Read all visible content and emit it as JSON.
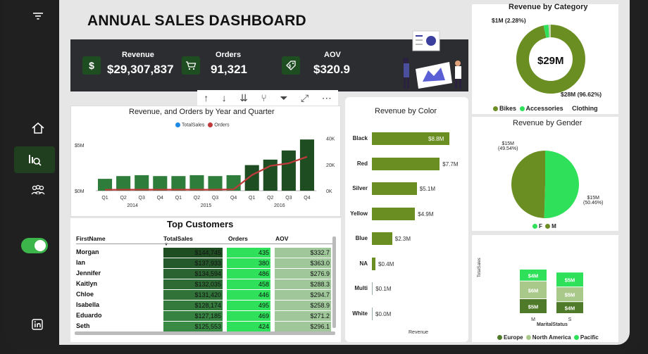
{
  "title": "ANNUAL SALES DASHBOARD",
  "colors": {
    "dark_green": "#1f5a2a",
    "olive": "#6b8e23",
    "bright_green": "#2ee05a",
    "line_red": "#c0393b",
    "kpi_band": "#2b2d30"
  },
  "sidebar": {
    "items": [
      {
        "name": "filter-icon"
      },
      {
        "name": "home-icon"
      },
      {
        "name": "analytics-icon"
      },
      {
        "name": "people-icon"
      },
      {
        "name": "toggle"
      },
      {
        "name": "linkedin-icon"
      }
    ]
  },
  "kpis": [
    {
      "label": "Revenue",
      "value": "$29,307,837",
      "icon": "$"
    },
    {
      "label": "Orders",
      "value": "91,321",
      "icon": "cart-icon"
    },
    {
      "label": "AOV",
      "value": "$320.9",
      "icon": "tag-icon"
    }
  ],
  "toolbar": {
    "icons": [
      "↑",
      "↓",
      "⇊",
      "⑂",
      "⏷",
      "⤢",
      "⋯"
    ]
  },
  "combo_chart": {
    "title": "Revenue, and Orders by Year and Quarter",
    "legend": [
      {
        "label": "TotalSales"
      },
      {
        "label": "Orders"
      }
    ],
    "left_ticks": [
      "$5M",
      "$0M"
    ],
    "right_ticks": [
      "40K",
      "20K",
      "0K"
    ],
    "quarters": [
      "Q1",
      "Q2",
      "Q3",
      "Q4",
      "Q1",
      "Q2",
      "Q3",
      "Q4",
      "Q1",
      "Q2",
      "Q3",
      "Q4"
    ],
    "years": [
      "2014",
      "2015",
      "2016"
    ]
  },
  "top_customers": {
    "title": "Top Customers",
    "headers": {
      "name": "FirstName",
      "sales": "TotalSales",
      "orders": "Orders",
      "aov": "AOV"
    },
    "rows": [
      {
        "name": "Morgan",
        "sales": "$144,745",
        "orders": "435",
        "aov": "$332.7"
      },
      {
        "name": "Ian",
        "sales": "$137,933",
        "orders": "380",
        "aov": "$363.0"
      },
      {
        "name": "Jennifer",
        "sales": "$134,594",
        "orders": "486",
        "aov": "$276.9"
      },
      {
        "name": "Kaitlyn",
        "sales": "$132,035",
        "orders": "458",
        "aov": "$288.3"
      },
      {
        "name": "Chloe",
        "sales": "$131,420",
        "orders": "446",
        "aov": "$294.7"
      },
      {
        "name": "Isabella",
        "sales": "$128,174",
        "orders": "495",
        "aov": "$258.9"
      },
      {
        "name": "Eduardo",
        "sales": "$127,185",
        "orders": "469",
        "aov": "$271.2"
      },
      {
        "name": "Seth",
        "sales": "$125,553",
        "orders": "424",
        "aov": "$296.1"
      }
    ]
  },
  "revenue_by_color": {
    "title": "Revenue by Color",
    "xlabel": "Revenue",
    "items": [
      {
        "label": "Black",
        "value": 8.8,
        "text": "$8.8M"
      },
      {
        "label": "Red",
        "value": 7.7,
        "text": "$7.7M"
      },
      {
        "label": "Silver",
        "value": 5.1,
        "text": "$5.1M"
      },
      {
        "label": "Yellow",
        "value": 4.9,
        "text": "$4.9M"
      },
      {
        "label": "Blue",
        "value": 2.3,
        "text": "$2.3M"
      },
      {
        "label": "NA",
        "value": 0.4,
        "text": "$0.4M"
      },
      {
        "label": "Multi",
        "value": 0.1,
        "text": "$0.1M"
      },
      {
        "label": "White",
        "value": 0.0,
        "text": "$0.0M"
      }
    ]
  },
  "revenue_by_category": {
    "title": "Revenue by Category",
    "center": "$29M",
    "label_small": "$1M (2.28%)",
    "label_large": "$28M (96.62%)",
    "legend": [
      "Bikes",
      "Accessories",
      "Clothing"
    ]
  },
  "revenue_by_gender": {
    "title": "Revenue by Gender",
    "label_left_1": "$15M",
    "label_left_2": "(49.54%)",
    "label_right_1": "$15M",
    "label_right_2": "(50.46%)",
    "legend": [
      "F",
      "M"
    ]
  },
  "marital_chart": {
    "ylabel": "TotalSales",
    "xlabel": "MaritalStatus",
    "legend": [
      "Europe",
      "North America",
      "Pacific"
    ]
  },
  "chart_data": [
    {
      "type": "bar",
      "title": "Revenue, and Orders by Year and Quarter",
      "categories": [
        "2014 Q1",
        "2014 Q2",
        "2014 Q3",
        "2014 Q4",
        "2015 Q1",
        "2015 Q2",
        "2015 Q3",
        "2015 Q4",
        "2016 Q1",
        "2016 Q2",
        "2016 Q3",
        "2016 Q4"
      ],
      "series": [
        {
          "name": "TotalSales",
          "values": [
            1.3,
            1.6,
            1.7,
            1.6,
            1.6,
            1.7,
            1.6,
            1.7,
            2.8,
            3.4,
            4.4,
            5.6
          ]
        },
        {
          "name": "Orders",
          "values": [
            0.7,
            0.8,
            0.8,
            0.8,
            0.8,
            0.8,
            0.8,
            1.0,
            12,
            19,
            21,
            26
          ]
        }
      ],
      "ylim": [
        0,
        6
      ]
    },
    {
      "type": "pie",
      "title": "Revenue by Category",
      "categories": [
        "Bikes",
        "Accessories",
        "Clothing"
      ],
      "values": [
        96.62,
        2.28,
        1.1
      ]
    },
    {
      "type": "pie",
      "title": "Revenue by Gender",
      "categories": [
        "F",
        "M"
      ],
      "values": [
        50.46,
        49.54
      ]
    },
    {
      "type": "bar",
      "categories": [
        "M",
        "S"
      ],
      "series": [
        {
          "name": "Europe",
          "values": [
            5,
            4
          ]
        },
        {
          "name": "North America",
          "values": [
            6,
            5
          ]
        },
        {
          "name": "Pacific",
          "values": [
            4,
            5
          ]
        }
      ],
      "labels": [
        [
          "$5M",
          "$6M",
          "$4M"
        ],
        [
          "$4M",
          "$5M",
          "$5M"
        ]
      ],
      "ylabel": "TotalSales",
      "xlabel": "MaritalStatus"
    }
  ]
}
